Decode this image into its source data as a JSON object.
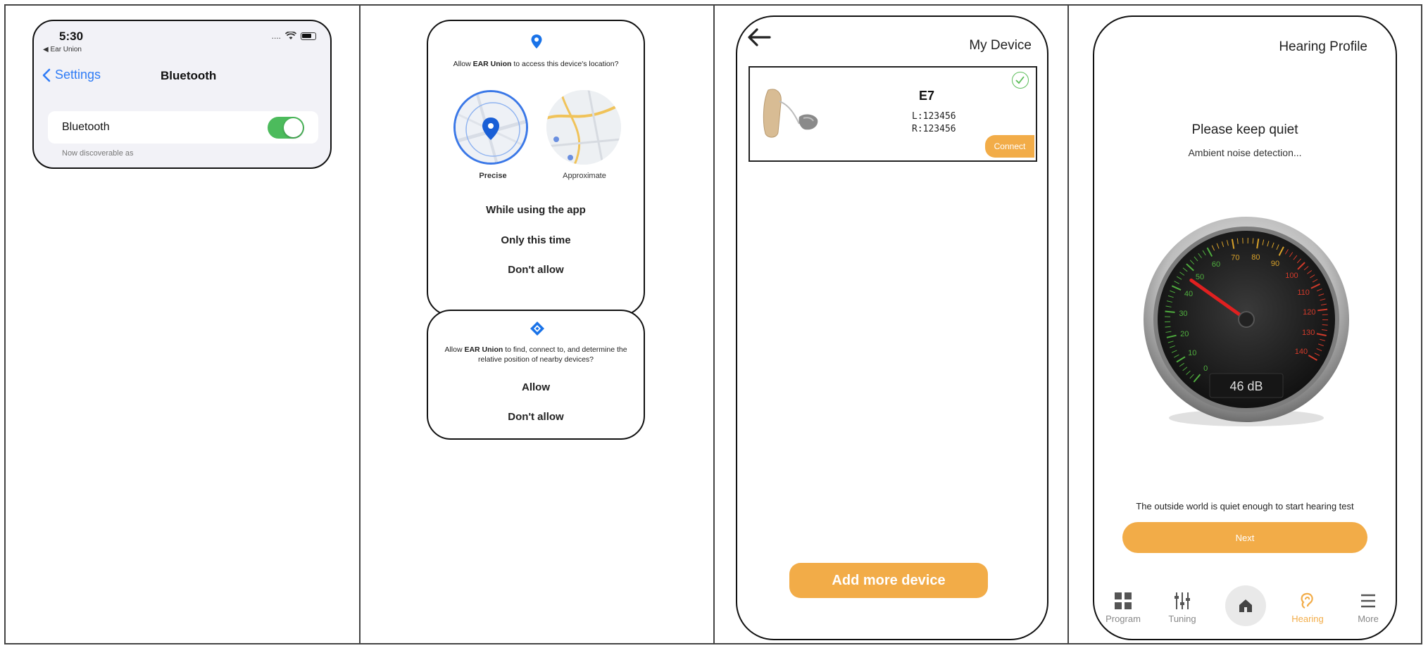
{
  "panel1": {
    "time": "5:30",
    "back_app": "◀ Ear Union",
    "signal": "....",
    "nav_back": "Settings",
    "nav_title": "Bluetooth",
    "row_label": "Bluetooth",
    "toggle_on": true,
    "discoverable_text": "Now discoverable as"
  },
  "panel2": {
    "location_prompt_pre": "Allow ",
    "app_name": "EAR Union",
    "location_prompt_post": " to access this device's location?",
    "precise_label": "Precise",
    "approximate_label": "Approximate",
    "option_while_using": "While using the app",
    "option_only_once": "Only this time",
    "option_dont_allow": "Don't allow",
    "nearby_prompt_pre": "Allow ",
    "nearby_prompt_post": " to find, connect to, and determine the relative position of nearby devices?",
    "nearby_allow": "Allow",
    "nearby_dont_allow": "Don't allow"
  },
  "panel3": {
    "title": "My Device",
    "device_name": "E7",
    "left_id": "L:123456",
    "right_id": "R:123456",
    "connect_label": "Connect",
    "add_more_label": "Add more device"
  },
  "panel4": {
    "title": "Hearing Profile",
    "heading": "Please keep quiet",
    "subheading": "Ambient noise detection...",
    "gauge_reading": "46 dB",
    "gauge_value_db": 46,
    "gauge_ticks": [
      "0",
      "10",
      "20",
      "30",
      "40",
      "50",
      "60",
      "70",
      "80",
      "90",
      "100",
      "110",
      "120",
      "130",
      "140"
    ],
    "quiet_message": "The outside world is quiet enough to start hearing test",
    "next_label": "Next",
    "tabs": [
      {
        "label": "Program",
        "icon": "grid-icon"
      },
      {
        "label": "Tuning",
        "icon": "sliders-icon"
      },
      {
        "label": "",
        "icon": "home-icon"
      },
      {
        "label": "Hearing",
        "icon": "ear-icon"
      },
      {
        "label": "More",
        "icon": "menu-icon"
      }
    ]
  },
  "colors": {
    "accent": "#f2ac48",
    "ios_blue": "#2f7cf6",
    "toggle_green": "#4cbb5c"
  }
}
